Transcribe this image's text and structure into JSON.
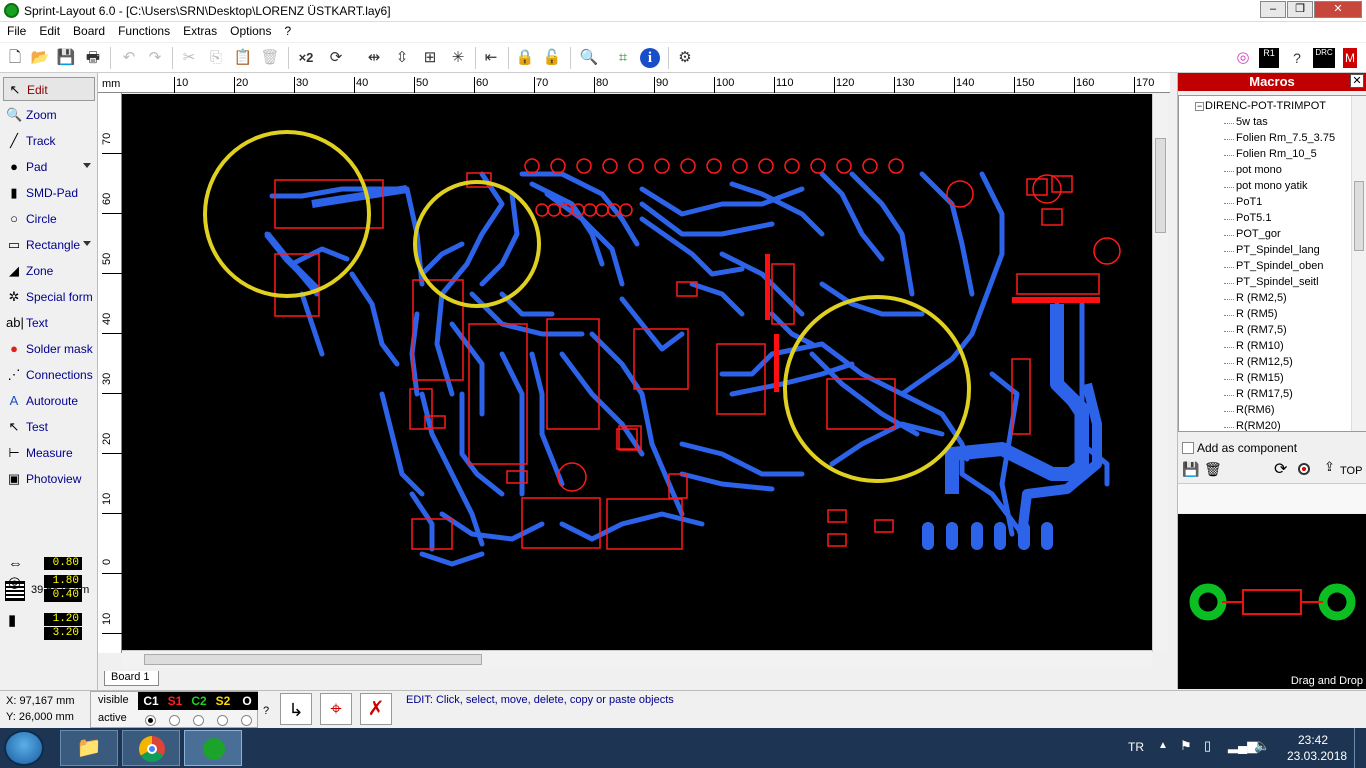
{
  "window": {
    "title": "Sprint-Layout 6.0 - [C:\\Users\\SRN\\Desktop\\LORENZ ÜSTKART.lay6]",
    "min": "–",
    "max": "❐",
    "close": "✕"
  },
  "menu": [
    "File",
    "Edit",
    "Board",
    "Functions",
    "Extras",
    "Options",
    "?"
  ],
  "toolbar": {
    "x2_label": "×2",
    "icons": [
      "new-icon",
      "open-icon",
      "save-icon",
      "print-icon",
      "undo-icon",
      "redo-icon",
      "cut-icon",
      "copy-icon",
      "paste-icon",
      "delete-icon",
      "duplicate-icon",
      "rotate-icon",
      "mirror-h-icon",
      "mirror-v-icon",
      "group-icon",
      "ungroup-icon",
      "align-icon",
      "lock-icon",
      "unlock-icon",
      "zoom-icon",
      "crop-icon",
      "info-icon",
      "settings-icon"
    ]
  },
  "tools": [
    {
      "label": "Edit",
      "icon": "cursor-icon",
      "glyph": "↖",
      "active": true
    },
    {
      "label": "Zoom",
      "icon": "zoom-icon",
      "glyph": "🔍"
    },
    {
      "label": "Track",
      "icon": "track-icon",
      "glyph": "╱"
    },
    {
      "label": "Pad",
      "icon": "pad-icon",
      "glyph": "●",
      "dropdown": true
    },
    {
      "label": "SMD-Pad",
      "icon": "smd-pad-icon",
      "glyph": "▮"
    },
    {
      "label": "Circle",
      "icon": "circle-icon",
      "glyph": "○"
    },
    {
      "label": "Rectangle",
      "icon": "rectangle-icon",
      "glyph": "▭",
      "dropdown": true
    },
    {
      "label": "Zone",
      "icon": "zone-icon",
      "glyph": "◢"
    },
    {
      "label": "Special form",
      "icon": "special-form-icon",
      "glyph": "✲"
    },
    {
      "label": "Text",
      "icon": "text-icon",
      "glyph": "ab|"
    },
    {
      "label": "Solder mask",
      "icon": "solder-mask-icon",
      "glyph": "●"
    },
    {
      "label": "Connections",
      "icon": "connections-icon",
      "glyph": "⋰"
    },
    {
      "label": "Autoroute",
      "icon": "autoroute-icon",
      "glyph": "A"
    },
    {
      "label": "Test",
      "icon": "test-icon",
      "glyph": "↖"
    },
    {
      "label": "Measure",
      "icon": "measure-icon",
      "glyph": "⊢"
    },
    {
      "label": "Photoview",
      "icon": "photoview-icon",
      "glyph": "▣"
    }
  ],
  "grid": {
    "value": "39,6875 µm"
  },
  "params": {
    "track_width": "0.80",
    "pad_outer": "1.80",
    "pad_inner": "0.40",
    "smd_w": "1.20",
    "smd_h": "3.20"
  },
  "ruler": {
    "unit": "mm",
    "top": [
      "10",
      "20",
      "30",
      "40",
      "50",
      "60",
      "70",
      "80",
      "90",
      "100",
      "110",
      "120",
      "130",
      "140",
      "150",
      "160",
      "170"
    ],
    "left": [
      "70",
      "60",
      "50",
      "40",
      "30",
      "20",
      "10",
      "0",
      "10"
    ]
  },
  "board_tab": "Board 1",
  "macros": {
    "title": "Macros",
    "folder": "DIRENC-POT-TRIMPOT",
    "items": [
      "5w tas",
      "Folien Rm_7.5_3.75",
      "Folien Rm_10_5",
      "pot mono",
      "pot mono yatik",
      "PoT1",
      "PoT5.1",
      "POT_gor",
      "PT_Spindel_lang",
      "PT_Spindel_oben",
      "PT_Spindel_seitl",
      "R (RM2,5)",
      "R (RM5)",
      "R (RM7,5)",
      "R (RM10)",
      "R (RM12,5)",
      "R (RM15)",
      "R (RM17,5)",
      "R(RM6)",
      "R(RM20)"
    ],
    "add_as_component": "Add as component",
    "top_label": "TOP",
    "drag_drop": "Drag and Drop"
  },
  "status": {
    "x": "X:   97,167 mm",
    "y": "Y:   26,000 mm",
    "visible": "visible",
    "active": "active",
    "layers": [
      {
        "name": "C1",
        "color": "#ffffff"
      },
      {
        "name": "S1",
        "color": "#ff2020"
      },
      {
        "name": "C2",
        "color": "#22cc22"
      },
      {
        "name": "S2",
        "color": "#ffd800"
      },
      {
        "name": "O",
        "color": "#ffffff"
      }
    ],
    "question": "?",
    "message": "EDIT:  Click, select, move, delete, copy or paste objects"
  },
  "taskbar": {
    "lang": "TR",
    "time": "23:42",
    "date": "23.03.2018"
  },
  "colors": {
    "track": "#2c63e8",
    "silk": "#ff1a1a",
    "highlight": "#e0d020"
  }
}
